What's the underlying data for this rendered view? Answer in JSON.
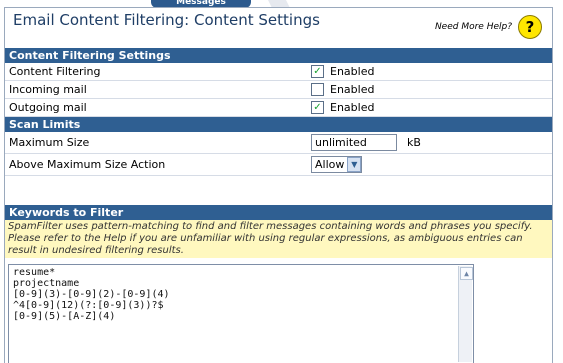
{
  "tab": {
    "label": "Messages"
  },
  "title": "Email Content Filtering: Content Settings",
  "help": {
    "text": "Need More Help?",
    "icon": "question-mark-icon"
  },
  "sections": {
    "content": {
      "title": "Content Filtering Settings",
      "rows": [
        {
          "label": "Content Filtering",
          "checked": true,
          "value_label": "Enabled"
        },
        {
          "label": "Incoming mail",
          "checked": false,
          "value_label": "Enabled"
        },
        {
          "label": "Outgoing mail",
          "checked": true,
          "value_label": "Enabled"
        }
      ]
    },
    "scan": {
      "title": "Scan Limits",
      "max_size": {
        "label": "Maximum Size",
        "value": "unlimited",
        "unit": "kB"
      },
      "action": {
        "label": "Above Maximum Size Action",
        "value": "Allow"
      }
    },
    "keywords": {
      "title": "Keywords to Filter",
      "notice": "SpamFilter uses pattern-matching to find and filter messages containing words and phrases you specify. Please refer to the Help if you are unfamiliar with using regular expressions, as ambiguous entries can result in undesired filtering results.",
      "lines": [
        "resume*",
        "projectname",
        "[0-9](3)-[0-9](2)-[0-9](4)",
        "^4[0-9](12)(?:[0-9](3))?$",
        "[0-9](5)-[A-Z](4)"
      ]
    }
  }
}
